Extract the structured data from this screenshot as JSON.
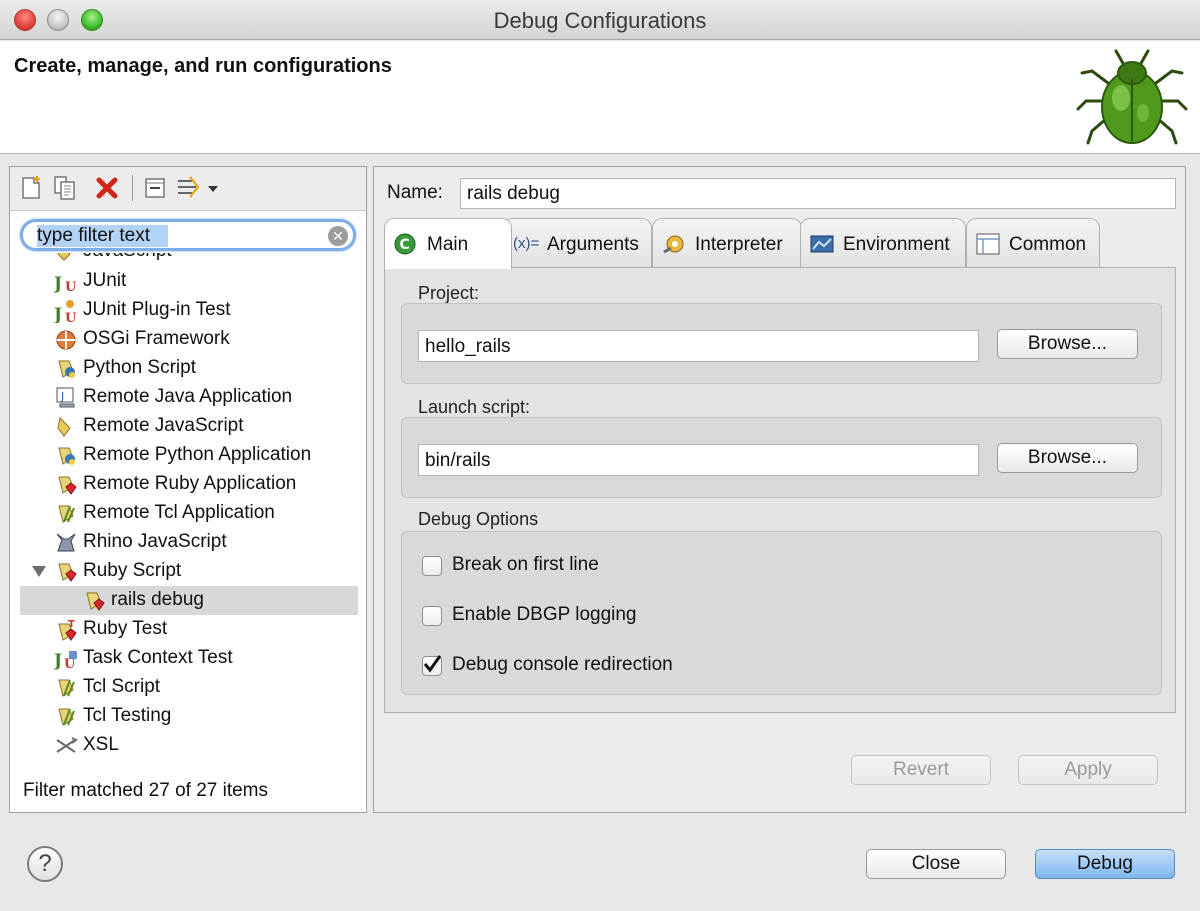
{
  "window": {
    "title": "Debug Configurations"
  },
  "banner": {
    "title": "Create, manage, and run configurations"
  },
  "filter": {
    "value": "type filter text"
  },
  "tree": {
    "items": [
      {
        "label": "JavaScript"
      },
      {
        "label": "JUnit"
      },
      {
        "label": "JUnit Plug-in Test"
      },
      {
        "label": "OSGi Framework"
      },
      {
        "label": "Python Script"
      },
      {
        "label": "Remote Java Application"
      },
      {
        "label": "Remote JavaScript"
      },
      {
        "label": "Remote Python Application"
      },
      {
        "label": "Remote Ruby Application"
      },
      {
        "label": "Remote Tcl Application"
      },
      {
        "label": "Rhino JavaScript"
      },
      {
        "label": "Ruby Script"
      },
      {
        "label": "rails debug"
      },
      {
        "label": "Ruby Test"
      },
      {
        "label": "Task Context Test"
      },
      {
        "label": "Tcl Script"
      },
      {
        "label": "Tcl Testing"
      },
      {
        "label": "XSL"
      }
    ],
    "status": "Filter matched 27 of 27 items"
  },
  "config": {
    "name_label": "Name:",
    "name_value": "rails debug",
    "tabs": [
      {
        "label": "Main"
      },
      {
        "label": "Arguments"
      },
      {
        "label": "Interpreter"
      },
      {
        "label": "Environment"
      },
      {
        "label": "Common"
      }
    ],
    "arguments_icon_text": "(x)=",
    "project_label": "Project:",
    "project_value": "hello_rails",
    "launch_label": "Launch script:",
    "launch_value": "bin/rails",
    "browse_label": "Browse...",
    "debug_options_label": "Debug Options",
    "options": [
      {
        "label": "Break on first line",
        "checked": false
      },
      {
        "label": "Enable DBGP logging",
        "checked": false
      },
      {
        "label": "Debug console redirection",
        "checked": true
      }
    ],
    "revert_label": "Revert",
    "apply_label": "Apply"
  },
  "footer": {
    "help_label": "?",
    "close_label": "Close",
    "debug_label": "Debug"
  }
}
